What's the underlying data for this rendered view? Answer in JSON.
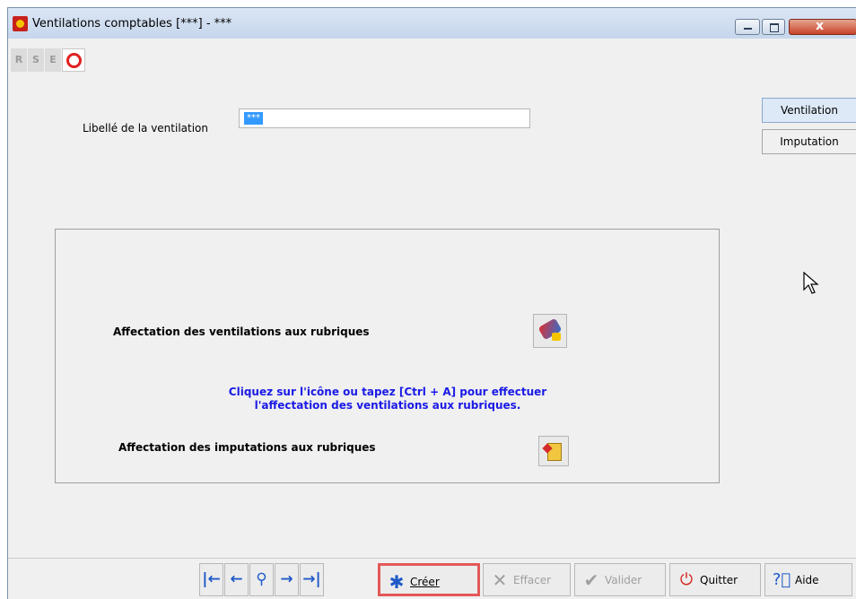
{
  "window": {
    "title": "Ventilations comptables [***] - ***",
    "close_glyph": "x",
    "controls": [
      "minimize-icon",
      "maximize-icon",
      "close-icon"
    ]
  },
  "rse_toolbar": {
    "r": "R",
    "s": "S",
    "e": "E",
    "o_icon": "power-ring-icon"
  },
  "form": {
    "libelle_label": "Libellé de la ventilation",
    "libelle_value": "***"
  },
  "tabs": [
    {
      "label": "Ventilation",
      "active": true
    },
    {
      "label": "Imputation",
      "active": false
    }
  ],
  "panel": {
    "affectation_ventilations": "Affectation des ventilations aux rubriques",
    "help_line1": "Cliquez sur l'icône ou tapez [Ctrl + A] pour effectuer",
    "help_line2": "l'affectation des ventilations aux rubriques.",
    "affectation_imputations": "Affectation des imputations aux rubriques"
  },
  "bottom_bar": {
    "nav": [
      {
        "name": "first",
        "glyph": "|←"
      },
      {
        "name": "previous",
        "glyph": "←"
      },
      {
        "name": "search",
        "glyph": "⚲"
      },
      {
        "name": "next",
        "glyph": "→"
      },
      {
        "name": "last",
        "glyph": "→|"
      }
    ],
    "creer": "Créer",
    "effacer": "Effacer",
    "valider": "Valider",
    "quitter": "Quitter",
    "aide": "Aide"
  },
  "colors": {
    "help_text": "#1a1ae6",
    "selection": "#3399ff",
    "highlight_border": "#e45959"
  }
}
